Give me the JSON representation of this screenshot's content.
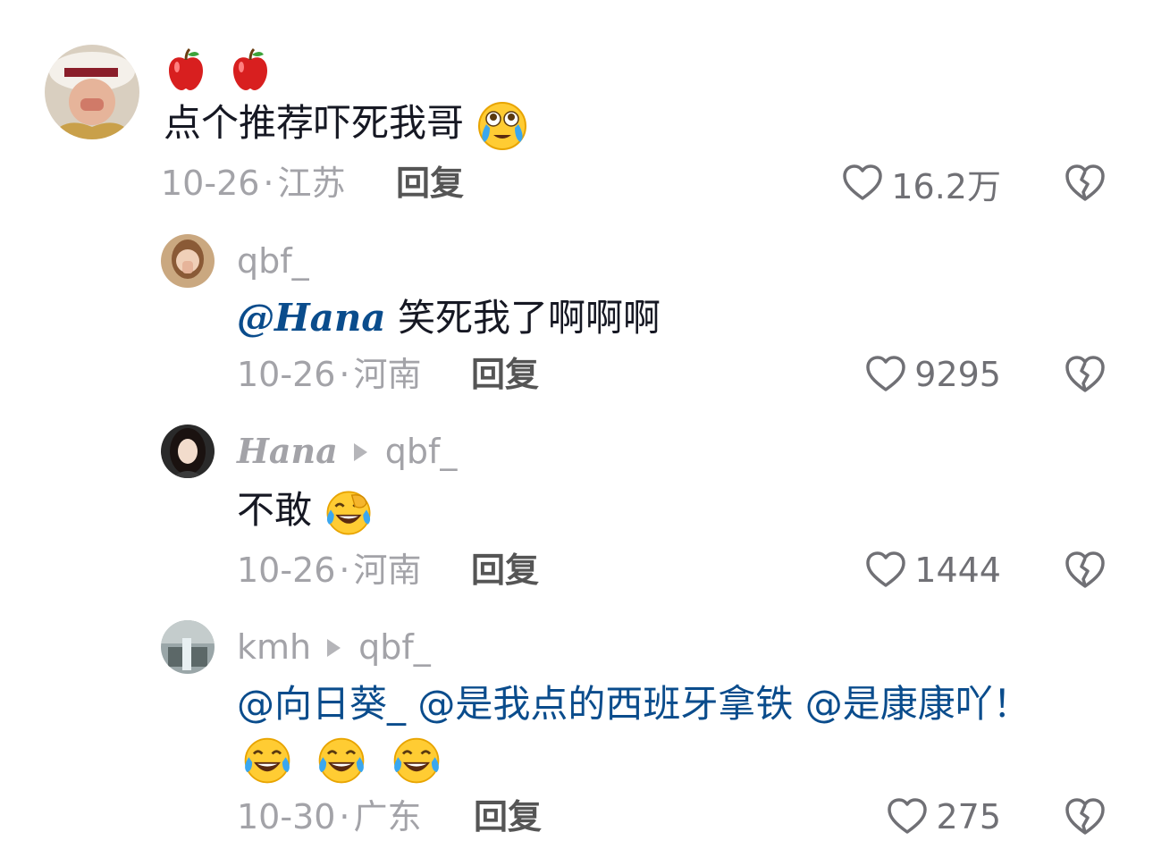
{
  "comments": [
    {
      "emoji_line": "🍎🍎",
      "text": "点个推荐吓死我哥",
      "date": "10-26",
      "location": "江苏",
      "reply": "回复",
      "likes": "16.2万"
    },
    {
      "author": "qbf_",
      "mention": "@Hana",
      "text": "笑死我了啊啊啊",
      "date": "10-26",
      "location": "河南",
      "reply": "回复",
      "likes": "9295"
    },
    {
      "author": "Hana",
      "reply_to": "qbf_",
      "text": "不敢",
      "date": "10-26",
      "location": "河南",
      "reply": "回复",
      "likes": "1444"
    },
    {
      "author": "kmh",
      "reply_to": "qbf_",
      "mentions": "@向日葵_ @是我点的西班牙拿铁 @是康康吖！",
      "date": "10-30",
      "location": "广东",
      "reply": "回复",
      "likes": "275"
    }
  ],
  "icons": {
    "like": "heart-outline-icon",
    "dislike": "broken-heart-icon",
    "emoji_cry_laugh": "laugh-cry-emoji",
    "emoji_face_palm": "facepalm-laugh-emoji",
    "emoji_teary": "teary-eyes-emoji",
    "emoji_apple": "apple-emoji"
  },
  "colors": {
    "mention": "#0a4c8c",
    "meta": "#a3a3a8"
  }
}
